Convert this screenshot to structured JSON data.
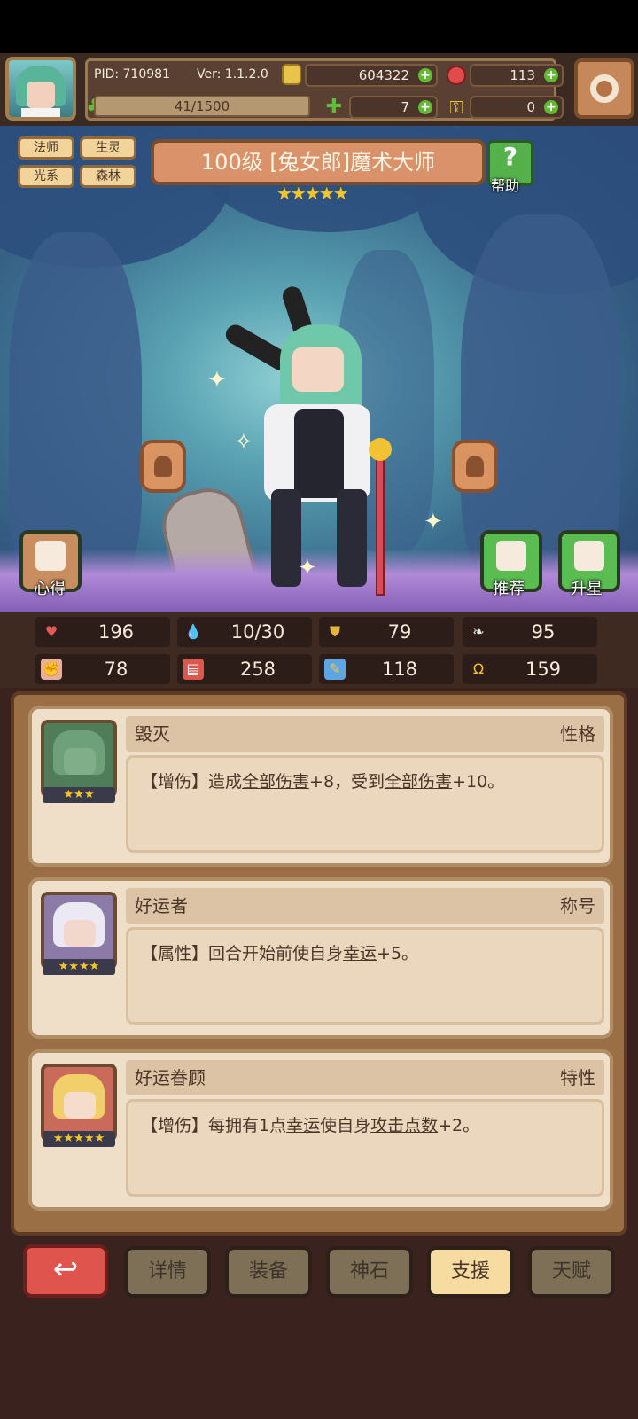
{
  "header": {
    "pid": "PID: 710981",
    "version": "Ver: 1.1.2.0",
    "gold": "604322",
    "gems": "113",
    "exp": "41/1500",
    "clover": "7",
    "keys": "0"
  },
  "tags": [
    "法师",
    "生灵",
    "光系",
    "森林"
  ],
  "hero": {
    "title": "100级 [兔女郎]魔术大师",
    "stars": "★★★★★",
    "help_label": "帮助",
    "notes_label": "心得",
    "recommend_label": "推荐",
    "starup_label": "升星"
  },
  "stats": [
    {
      "icon": "heart-icon",
      "value": "196"
    },
    {
      "icon": "mana-drop-icon",
      "value": "10/30"
    },
    {
      "icon": "shield-icon",
      "value": "79"
    },
    {
      "icon": "wing-icon",
      "value": "95"
    },
    {
      "icon": "fist-icon",
      "value": "78"
    },
    {
      "icon": "book-icon",
      "value": "258"
    },
    {
      "icon": "magic-icon",
      "value": "118"
    },
    {
      "icon": "horseshoe-icon",
      "value": "159"
    }
  ],
  "cards": [
    {
      "name": "毁灭",
      "type": "性格",
      "stars": "★★★",
      "desc_parts": [
        "【增伤】造成",
        "全部伤害",
        "+8，受到",
        "全部伤害",
        "+10。"
      ]
    },
    {
      "name": "好运者",
      "type": "称号",
      "stars": "★★★★",
      "desc_parts": [
        "【属性】回合开始前使自身",
        "幸运",
        "+5。"
      ]
    },
    {
      "name": "好运眷顾",
      "type": "特性",
      "stars": "★★★★★",
      "desc_parts": [
        "【增伤】每拥有1点",
        "幸运",
        "使自身",
        "攻击点数",
        "+2。"
      ]
    }
  ],
  "nav": {
    "back_icon": "↩",
    "details": "详情",
    "equip": "装备",
    "stone": "神石",
    "support": "支援",
    "talent": "天赋"
  },
  "colors": {
    "accent_active": "#f6dca0",
    "back_red": "#e0544e",
    "plus_green": "#63b836"
  }
}
